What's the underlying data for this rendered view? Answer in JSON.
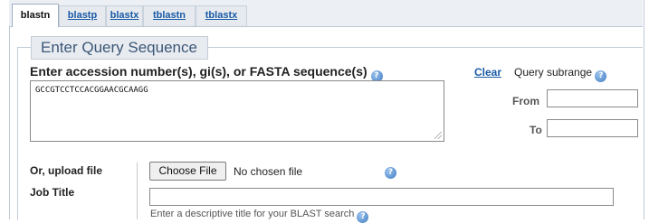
{
  "tabs": [
    {
      "label": "blastn",
      "active": true
    },
    {
      "label": "blastp",
      "active": false
    },
    {
      "label": "blastx",
      "active": false
    },
    {
      "label": "tblastn",
      "active": false
    },
    {
      "label": "tblastx",
      "active": false
    }
  ],
  "section": {
    "legend": "Enter Query Sequence"
  },
  "query": {
    "label": "Enter accession number(s), gi(s), or FASTA sequence(s)",
    "help_icon": "help-icon",
    "sequence": "GCCGTCCTCCACGGAACGCAAGG",
    "clear_label": "Clear"
  },
  "subrange": {
    "title": "Query subrange",
    "from_label": "From",
    "to_label": "To",
    "from_value": "",
    "to_value": ""
  },
  "upload": {
    "label": "Or, upload file",
    "button_label": "Choose File",
    "status": "No chosen file"
  },
  "job_title": {
    "label": "Job Title",
    "value": "",
    "hint": "Enter a descriptive title for your BLAST search"
  },
  "colors": {
    "link": "#1a5aa6",
    "legend_text": "#3b5677",
    "help_icon": "#3f7cc4"
  }
}
